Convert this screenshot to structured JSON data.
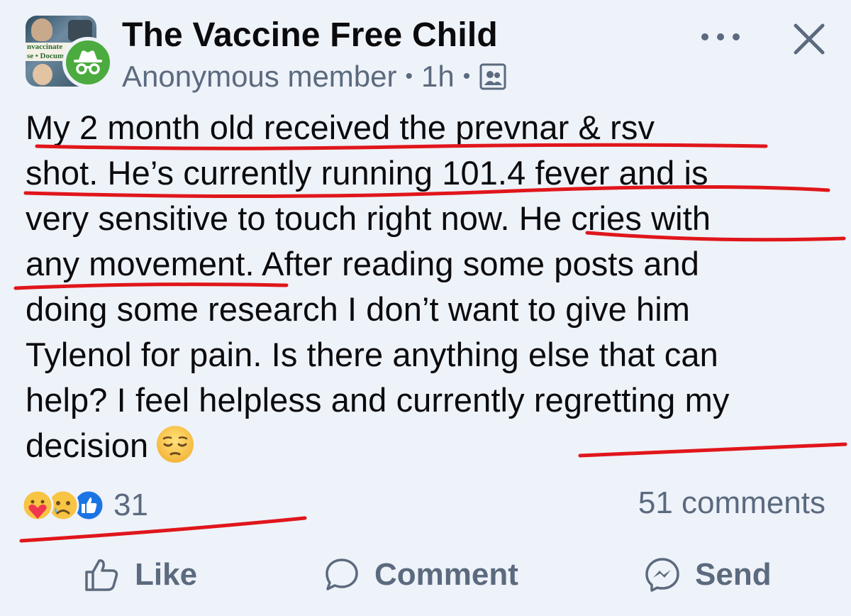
{
  "post": {
    "group_name": "The Vaccine Free Child",
    "author": "Anonymous member",
    "time": "1h",
    "avatar_text_top": "nvaccinate",
    "avatar_text_bottom": "se • Docume",
    "lines": [
      "My 2 month old received the prevnar & rsv",
      "shot. He’s currently running 101.4 fever and is",
      "very sensitive to touch right now. He cries with",
      "any movement. After reading some posts and",
      "doing some research I don’t want to give him",
      "Tylenol for pain. Is there anything else that can",
      "help? I feel helpless and currently regretting my",
      "decision"
    ],
    "reaction_count": "31",
    "comments_count": "51 comments"
  },
  "actions": {
    "like": "Like",
    "comment": "Comment",
    "send": "Send"
  },
  "icons": {
    "more": "more-icon",
    "close": "close-icon",
    "anonymous": "incognito-icon",
    "audience": "group-audience-icon",
    "sad_emoji": "pensive-face-emoji",
    "reactions": [
      "care-reaction-icon",
      "sad-reaction-icon",
      "like-reaction-icon"
    ]
  },
  "colors": {
    "background": "#eef2f9",
    "anon_badge": "#4bab3f",
    "secondary_text": "#5b6a7e",
    "annotation_red": "#e0161b",
    "like_blue": "#1b74e4"
  }
}
